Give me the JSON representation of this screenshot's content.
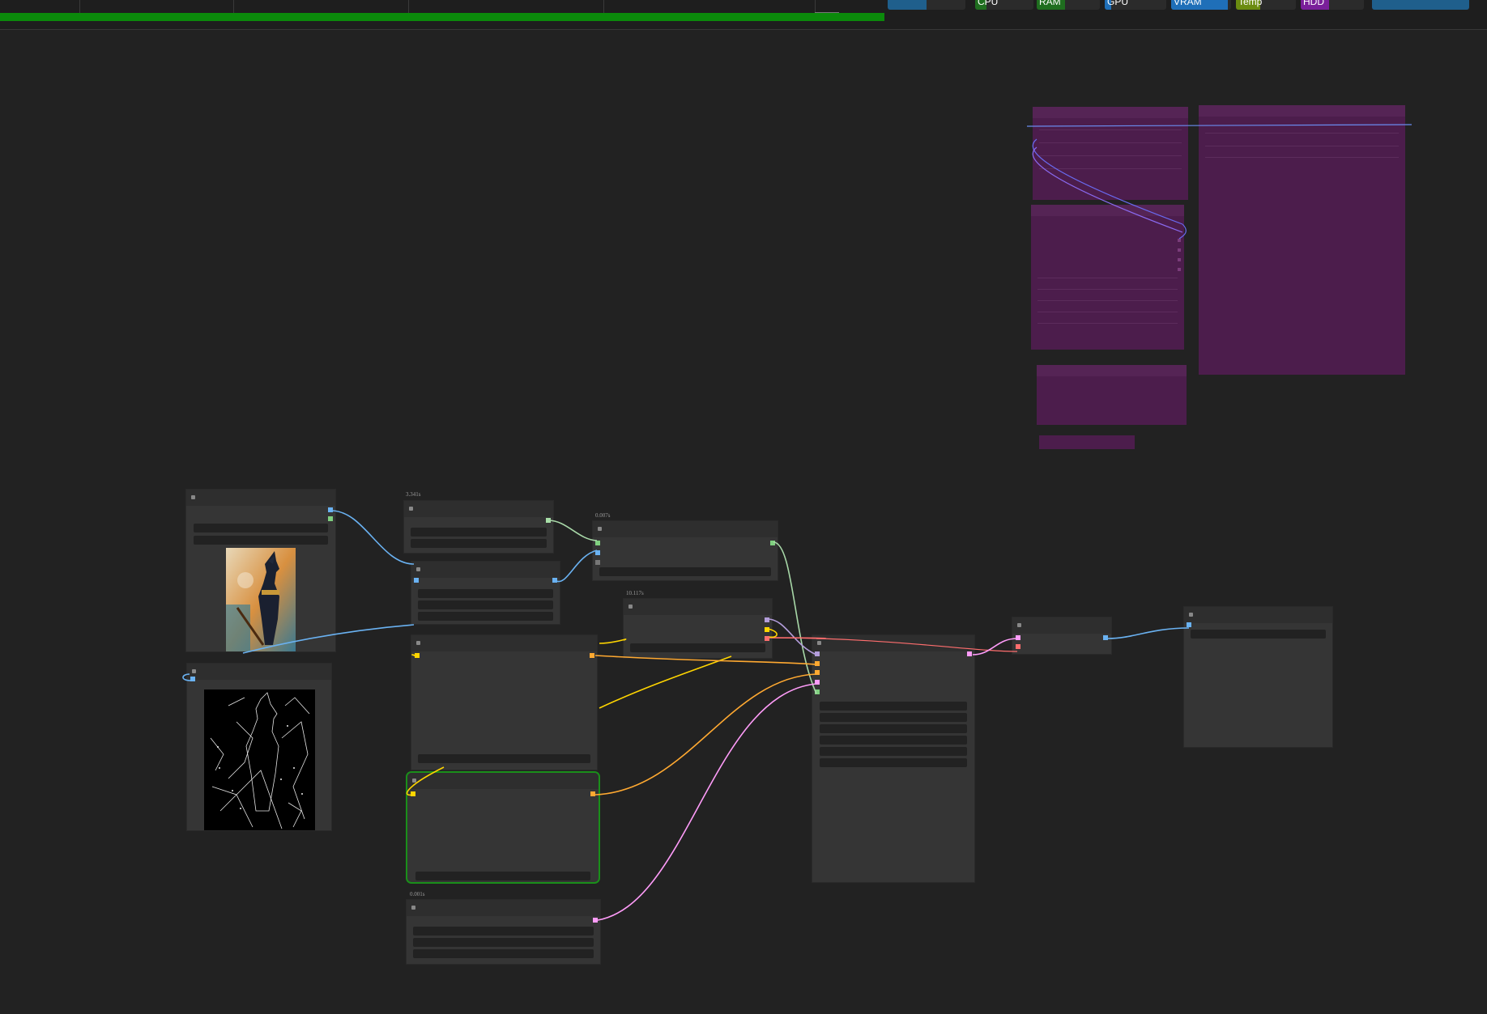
{
  "monitors": [
    {
      "label": "CPU",
      "color": "#1f6e1f",
      "level": 0.2
    },
    {
      "label": "RAM",
      "color": "#1f6e1f",
      "level": 0.45
    },
    {
      "label": "GPU",
      "color": "#1f6fb8",
      "level": 0.1
    },
    {
      "label": "VRAM",
      "color": "#1f6fb8",
      "level": 0.95
    },
    {
      "label": "Temp",
      "color": "#6b8c10",
      "level": 0.4
    },
    {
      "label": "HDD",
      "color": "#7a1f9a",
      "level": 0.45
    }
  ],
  "queue_progress": 0.7,
  "timers": {
    "node_a": "3.341s",
    "node_b": "0.007s",
    "node_c": "10.117s",
    "node_d": "0.001s"
  },
  "colors": {
    "image_link": "#6ab2f2",
    "model_link": "#a8d8a8",
    "conditioning_link": "#ffd500",
    "latent_link": "#ff9cf9",
    "control_link": "#ffa931",
    "vae_link": "#ff6e6e",
    "clip_link": "#b39ddb",
    "group_color": "#4c1d4c",
    "selected_outline": "#1a8f1a"
  }
}
